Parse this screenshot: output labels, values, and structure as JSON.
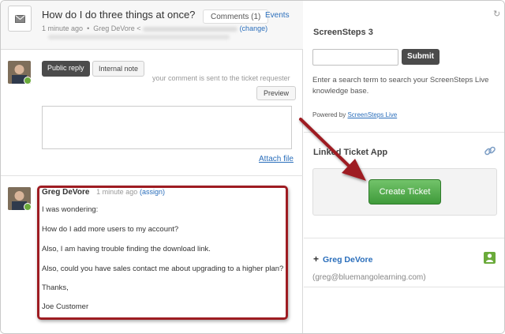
{
  "ticket": {
    "subject": "How do I do three things at once?",
    "comments_tab": "Comments (1)",
    "events_tab": "Events",
    "meta_time": "1 minute ago",
    "meta_dot": "•",
    "meta_author": "Greg DeVore <",
    "meta_change": "(change)"
  },
  "composer": {
    "public_reply": "Public reply",
    "internal_note": "Internal note",
    "requester_note": "your comment is sent to the ticket requester",
    "preview": "Preview",
    "attach_file": "Attach file"
  },
  "comment": {
    "author": "Greg DeVore",
    "time": "1 minute ago",
    "assign": "(assign)",
    "lines": [
      "I was wondering:",
      "How do I add more users to my account?",
      "Also, I am having trouble finding the download link.",
      "Also, could you have sales contact me about upgrading to a higher plan?",
      "Thanks,",
      "Joe Customer"
    ]
  },
  "screensteps": {
    "title": "ScreenSteps 3",
    "search_placeholder": "",
    "submit": "Submit",
    "description": "Enter a search term to search your ScreenSteps Live knowledge base.",
    "powered_by": "Powered by ",
    "powered_link": "ScreenSteps Live"
  },
  "linked_ticket": {
    "title": "Linked Ticket App",
    "create_button": "Create Ticket"
  },
  "requester": {
    "plus": "+",
    "name": "Greg DeVore",
    "email": "(greg@bluemangolearning.com)"
  },
  "colors": {
    "highlight": "#9e1c22",
    "create_green": "#4caf46",
    "link_blue": "#2a6ebb"
  }
}
